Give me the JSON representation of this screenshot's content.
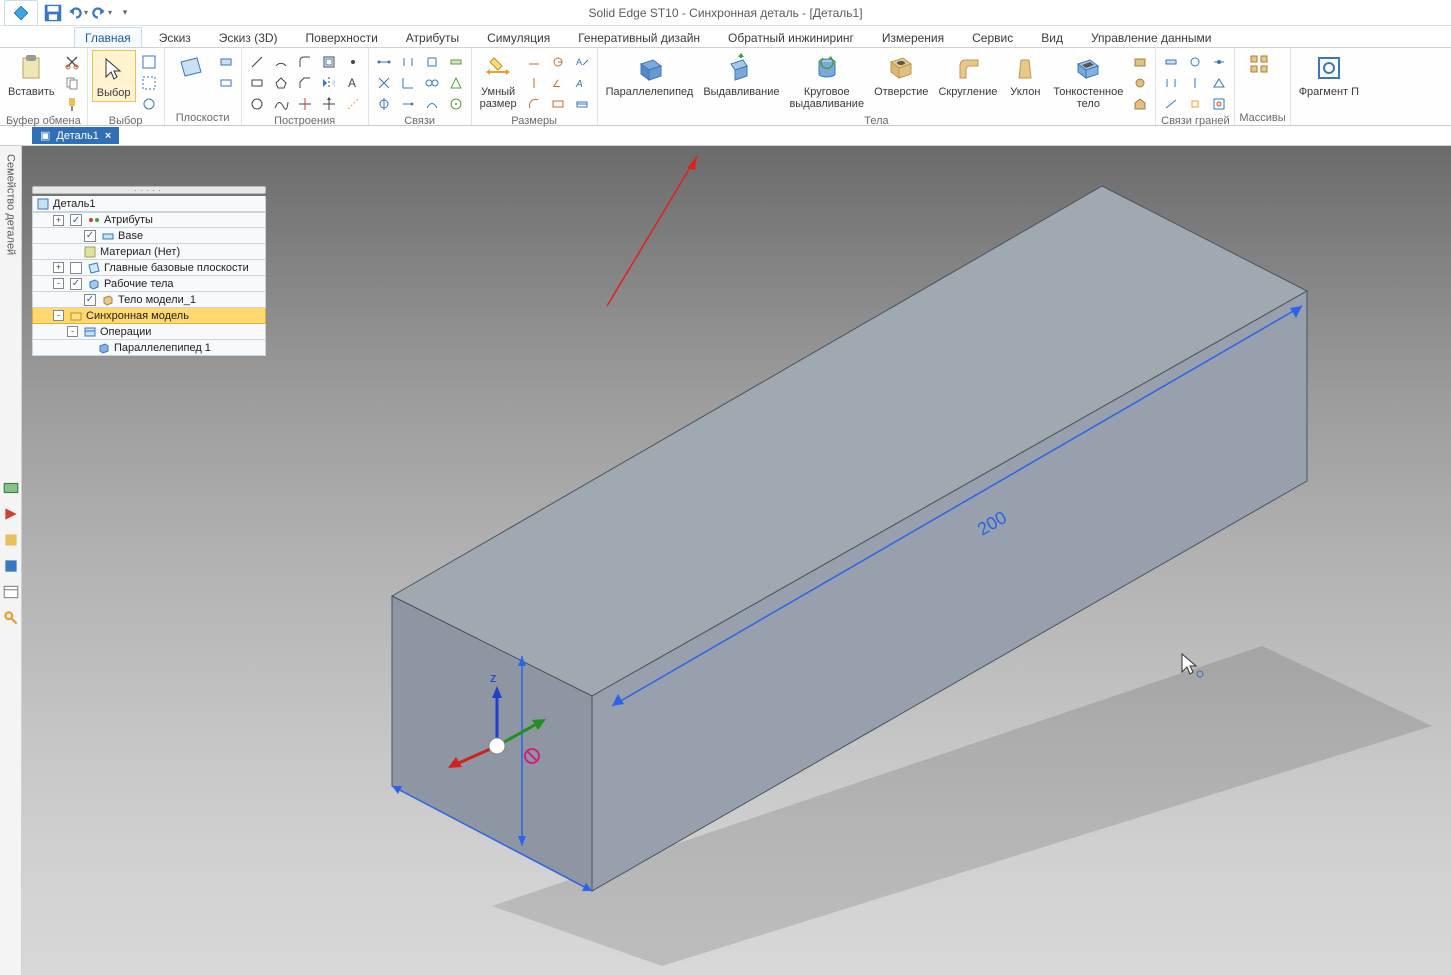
{
  "app_title": "Solid Edge ST10 - Синхронная деталь - [Деталь1]",
  "ribbon_tabs": [
    "Главная",
    "Эскиз",
    "Эскиз (3D)",
    "Поверхности",
    "Атрибуты",
    "Симуляция",
    "Генеративный дизайн",
    "Обратный инжиниринг",
    "Измерения",
    "Сервис",
    "Вид",
    "Управление данными"
  ],
  "groups": {
    "clipboard": {
      "label": "Буфер обмена",
      "paste": "Вставить"
    },
    "select": {
      "label": "Выбор",
      "select": "Выбор"
    },
    "planes": {
      "label": "Плоскости"
    },
    "draw": {
      "label": "Построения"
    },
    "relate": {
      "label": "Связи"
    },
    "dims": {
      "label": "Размеры",
      "smart": "Умный\nразмер"
    },
    "solids": {
      "label": "Тела",
      "box": "Параллелепипед",
      "extrude": "Выдавливание",
      "revolve": "Круговое\nвыдавливание",
      "hole": "Отверстие",
      "round": "Скругление",
      "draft": "Уклон",
      "thin": "Тонкостенное\nтело"
    },
    "facerel": {
      "label": "Связи граней"
    },
    "pattern": {
      "label": "Массивы"
    },
    "fragment": {
      "label": "",
      "btn": "Фрагмент П"
    }
  },
  "doc_tab": "Деталь1",
  "side_label": "Семейство деталей",
  "tree": {
    "root": "Деталь1",
    "items": [
      {
        "indent": 1,
        "pm": "+",
        "chk": true,
        "ico": "attr",
        "label": "Атрибуты"
      },
      {
        "indent": 2,
        "pm": "",
        "chk": true,
        "ico": "base",
        "label": "Base"
      },
      {
        "indent": 2,
        "pm": "",
        "chk": null,
        "ico": "mat",
        "label": "Материал (Нет)"
      },
      {
        "indent": 1,
        "pm": "+",
        "chk": false,
        "ico": "planes",
        "label": "Главные базовые плоскости"
      },
      {
        "indent": 1,
        "pm": "-",
        "chk": true,
        "ico": "body",
        "label": "Рабочие тела"
      },
      {
        "indent": 2,
        "pm": "",
        "chk": true,
        "ico": "solid",
        "label": "Тело модели_1"
      },
      {
        "indent": 1,
        "pm": "-",
        "chk": null,
        "ico": "sync",
        "label": "Синхронная модель",
        "sel": true
      },
      {
        "indent": 2,
        "pm": "-",
        "chk": null,
        "ico": "ops",
        "label": "Операции"
      },
      {
        "indent": 3,
        "pm": "",
        "chk": null,
        "ico": "boxop",
        "label": "Параллелепипед 1"
      }
    ]
  },
  "dimension_value": "200"
}
